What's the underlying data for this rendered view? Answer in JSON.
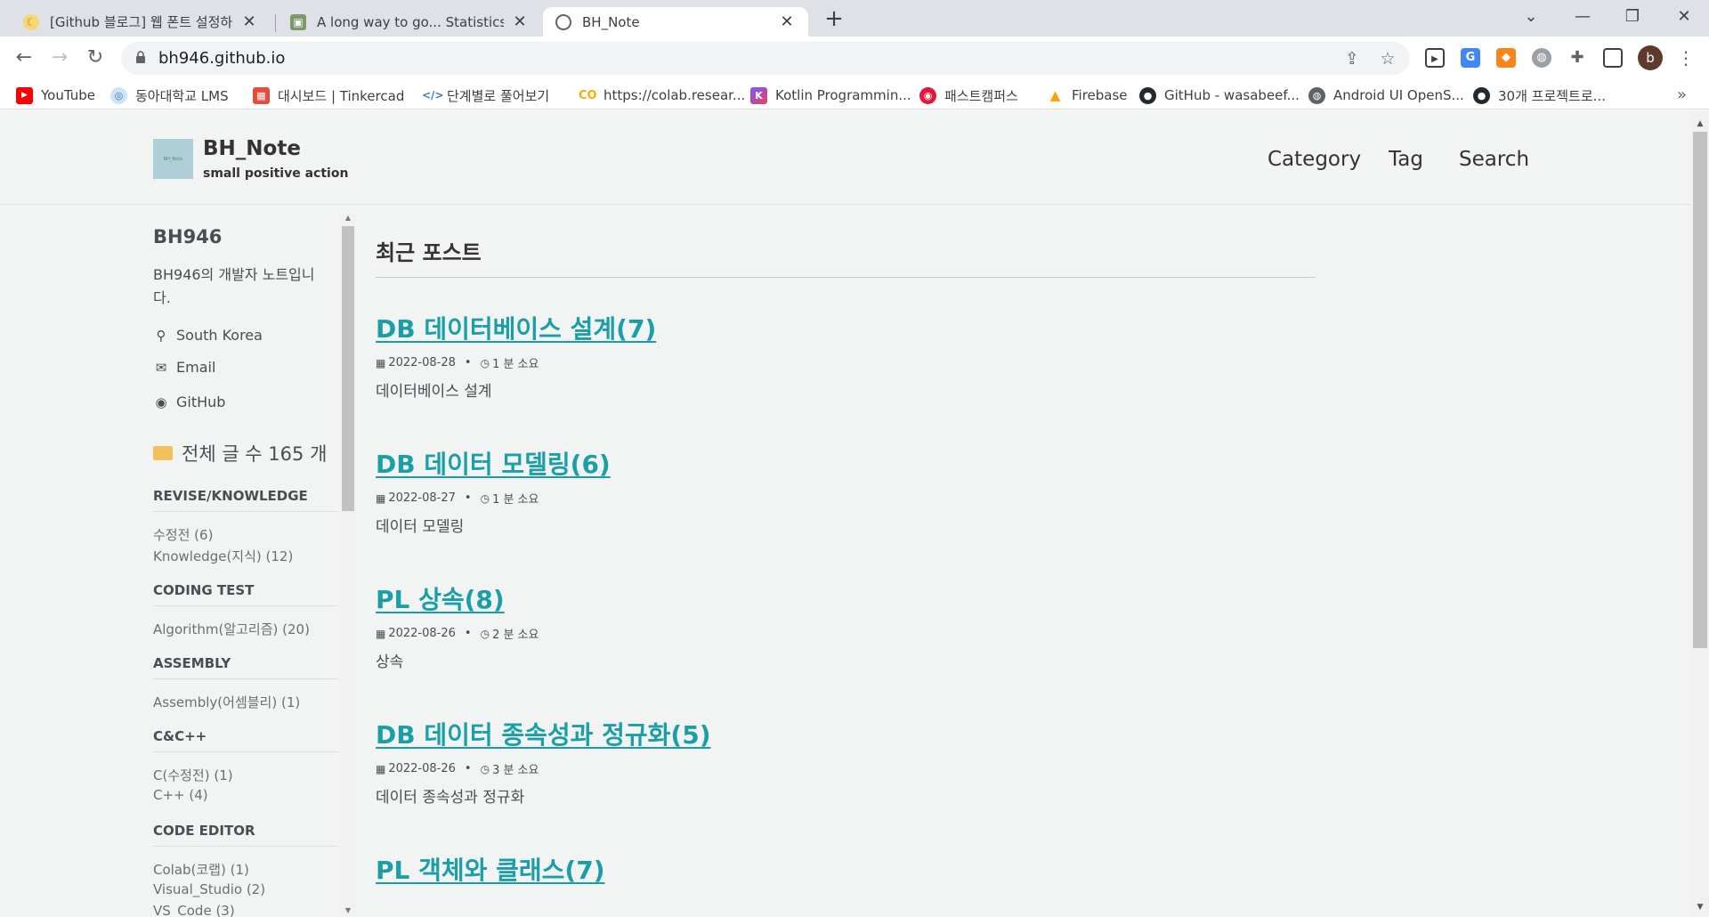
{
  "browser": {
    "tabs": [
      {
        "title": "[Github 블로그] 웹 폰트 설정하기",
        "active": false
      },
      {
        "title": "A long way to go... Statistics / 통계",
        "active": false
      },
      {
        "title": "BH_Note",
        "active": true
      }
    ],
    "url": "bh946.github.io",
    "avatar_letter": "b",
    "bookmarks": [
      {
        "label": "YouTube",
        "icon": "youtube-icon"
      },
      {
        "label": "동아대학교 LMS",
        "icon": "lms-icon"
      },
      {
        "label": "대시보드 | Tinkercad",
        "icon": "tinkercad-icon"
      },
      {
        "label": "단계별로 풀어보기",
        "icon": "code-icon"
      },
      {
        "label": "https://colab.resear...",
        "icon": "colab-icon"
      },
      {
        "label": "Kotlin Programmin...",
        "icon": "kotlin-icon"
      },
      {
        "label": "패스트캠퍼스",
        "icon": "fastcampus-icon"
      },
      {
        "label": "Firebase",
        "icon": "firebase-icon"
      },
      {
        "label": "GitHub - wasabeef...",
        "icon": "github-icon"
      },
      {
        "label": "Android UI OpenS...",
        "icon": "globe-icon"
      },
      {
        "label": "30개 프로젝트로...",
        "icon": "github-icon"
      }
    ]
  },
  "site": {
    "title": "BH_Note",
    "subtitle": "small positive action",
    "nav": [
      "Category",
      "Tag",
      "Search"
    ]
  },
  "author": {
    "name": "BH946",
    "bio": "BH946의 개발자 노트입니다.",
    "location": "South Korea",
    "email": "Email",
    "github": "GitHub"
  },
  "total_posts": "전체 글 수 165 개",
  "categories": [
    {
      "heading": "REVISE/KNOWLEDGE",
      "items": [
        "수정전 (6)",
        "Knowledge(지식) (12)"
      ]
    },
    {
      "heading": "CODING TEST",
      "items": [
        "Algorithm(알고리즘) (20)"
      ]
    },
    {
      "heading": "ASSEMBLY",
      "items": [
        "Assembly(어셈블리) (1)"
      ]
    },
    {
      "heading": "C&C++",
      "items": [
        "C(수정전) (1)",
        "C++ (4)"
      ]
    },
    {
      "heading": "CODE EDITOR",
      "items": [
        "Colab(코랩) (1)",
        "Visual_Studio (2)",
        "VS_Code (3)"
      ]
    }
  ],
  "recent_heading": "최근 포스트",
  "posts": [
    {
      "title": "DB 데이터베이스 설계(7)",
      "date": "2022-08-28",
      "read": "1 분 소요",
      "excerpt": "데이터베이스 설계"
    },
    {
      "title": "DB 데이터 모델링(6)",
      "date": "2022-08-27",
      "read": "1 분 소요",
      "excerpt": "데이터 모델링"
    },
    {
      "title": "PL 상속(8)",
      "date": "2022-08-26",
      "read": "2 분 소요",
      "excerpt": "상속"
    },
    {
      "title": "DB 데이터 종속성과 정규화(5)",
      "date": "2022-08-26",
      "read": "3 분 소요",
      "excerpt": "데이터 종속성과 정규화"
    },
    {
      "title": "PL 객체와 클래스(7)",
      "date": "",
      "read": "",
      "excerpt": ""
    }
  ],
  "colors": {
    "link": "#1a9fa8",
    "page_bg": "#f2f3f3",
    "tabstrip": "#dee1e6"
  }
}
